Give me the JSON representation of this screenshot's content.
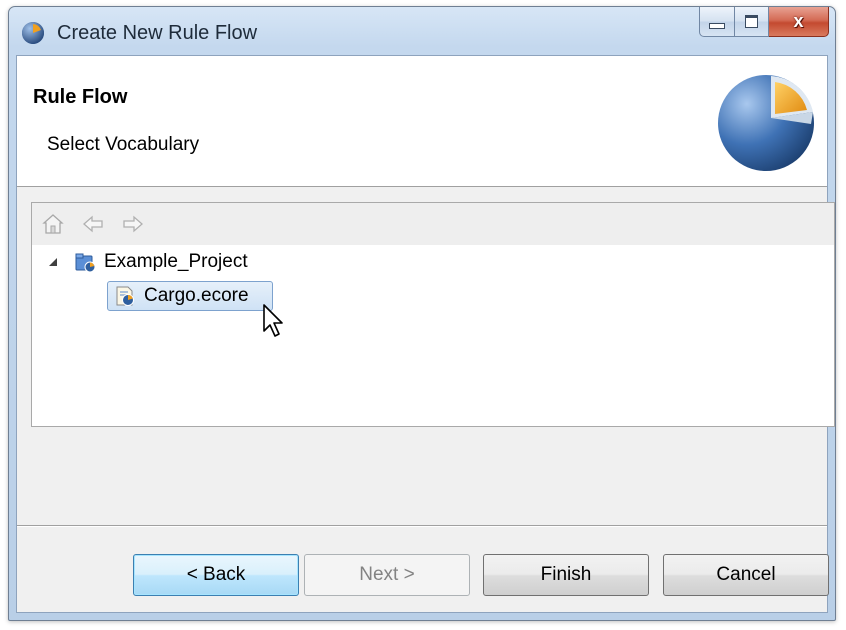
{
  "window": {
    "title": "Create New Rule Flow",
    "controls": {
      "minimize": "minimize",
      "maximize": "maximize",
      "close": "x"
    }
  },
  "header": {
    "title": "Rule Flow",
    "description": "Select Vocabulary",
    "logo_icon": "pie-logo-icon"
  },
  "toolbar": {
    "items": [
      {
        "name": "home-icon",
        "enabled": false
      },
      {
        "name": "back-arrow-icon",
        "enabled": false
      },
      {
        "name": "forward-arrow-icon",
        "enabled": false
      }
    ]
  },
  "tree": {
    "nodes": [
      {
        "label": "Example_Project",
        "icon": "project-folder-icon",
        "expanded": true,
        "selected": false
      },
      {
        "label": "Cargo.ecore",
        "icon": "vocabulary-file-icon",
        "selected": true
      }
    ]
  },
  "buttons": {
    "back": "< Back",
    "next": "Next >",
    "finish": "Finish",
    "cancel": "Cancel"
  },
  "colors": {
    "accent_blue": "#3c7fb1",
    "selection_bg": "#cfe2f5",
    "close_red": "#c44a30",
    "logo_blue": "#2f5f9e",
    "logo_orange": "#f0a020"
  }
}
